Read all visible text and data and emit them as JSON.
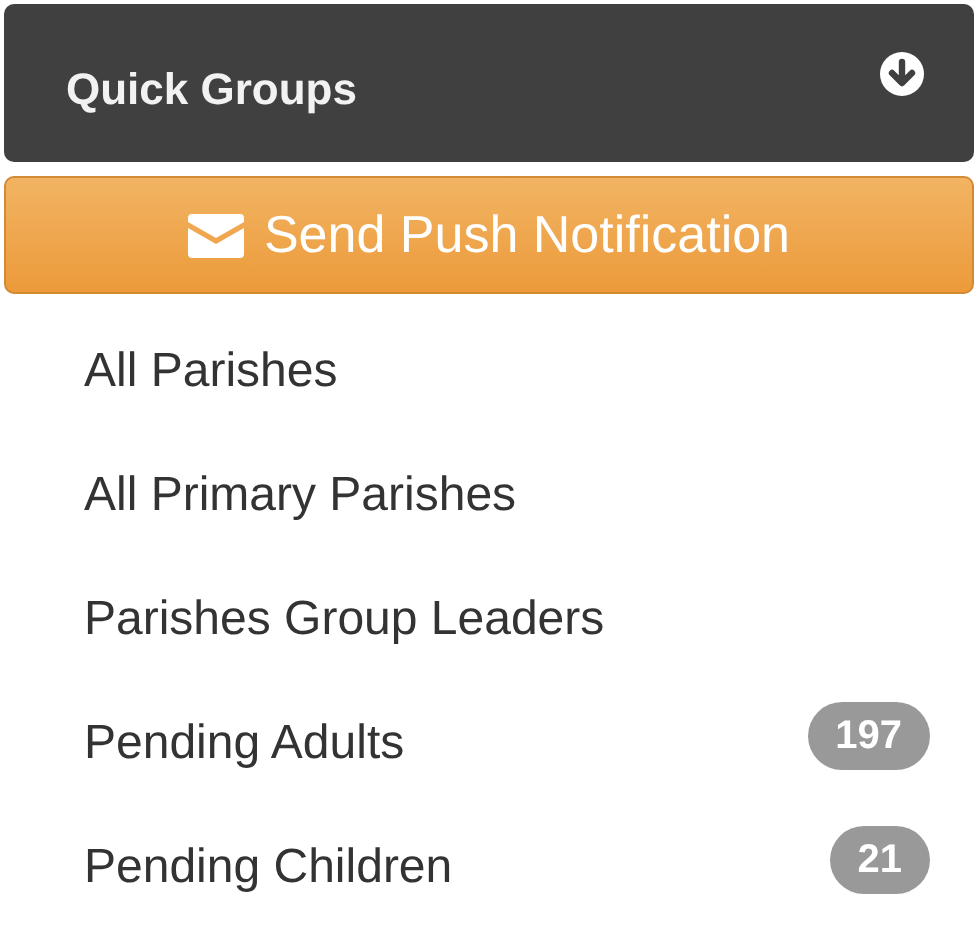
{
  "panel": {
    "title": "Quick Groups"
  },
  "push_button": {
    "label": "Send Push Notification"
  },
  "groups": [
    {
      "name": "All Parishes"
    },
    {
      "name": "All Primary Parishes"
    },
    {
      "name": "Parishes Group Leaders"
    },
    {
      "name": "Pending Adults",
      "count": "197"
    },
    {
      "name": "Pending Children",
      "count": "21"
    }
  ]
}
